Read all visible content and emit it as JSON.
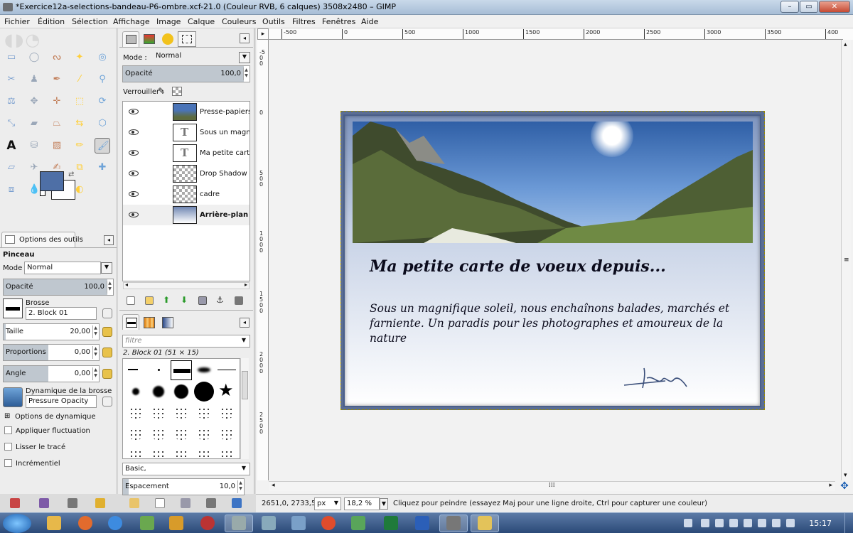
{
  "window": {
    "title": "*Exercice12a-selections-bandeau-P6-ombre.xcf-21.0 (Couleur RVB, 6 calques) 3508x2480 – GIMP",
    "minimize": "–",
    "maximize": "▭",
    "close": "✕"
  },
  "menu": [
    "Fichier",
    "Édition",
    "Sélection",
    "Affichage",
    "Image",
    "Calque",
    "Couleurs",
    "Outils",
    "Filtres",
    "Fenêtres",
    "Aide"
  ],
  "tool_options": {
    "tab_label": "Options des outils",
    "tool_name": "Pinceau",
    "mode_label": "Mode :",
    "mode_value": "Normal",
    "opacity_label": "Opacité",
    "opacity_value": "100,0",
    "opacity_fraction": 1.0,
    "brush_label": "Brosse",
    "brush_value": "2. Block 01",
    "size_label": "Taille",
    "size_value": "20,00",
    "size_fraction": 0.02,
    "aspect_label": "Proportions",
    "aspect_value": "0,00",
    "aspect_fraction": 0.5,
    "angle_label": "Angle",
    "angle_value": "0,00",
    "angle_fraction": 0.5,
    "dynamics_label": "Dynamique de la brosse",
    "dynamics_value": "Pressure Opacity",
    "dynamics_options": "Options de dynamique",
    "apply_jitter": "Appliquer fluctuation",
    "smooth_stroke": "Lisser le tracé",
    "incremental": "Incrémentiel"
  },
  "layers_panel": {
    "mode_label": "Mode :",
    "mode_value": "Normal",
    "opacity_label": "Opacité",
    "opacity_value": "100,0",
    "opacity_fraction": 1.0,
    "lock_label": "Verrouiller :",
    "layers": [
      {
        "name": "Presse-papiers",
        "thumb": "photo",
        "bold": false
      },
      {
        "name": "Sous un magnifi",
        "thumb": "text",
        "bold": false
      },
      {
        "name": "Ma petite carte d",
        "thumb": "text",
        "bold": false
      },
      {
        "name": "Drop Shadow",
        "thumb": "checker",
        "bold": false
      },
      {
        "name": "cadre",
        "thumb": "checker",
        "bold": false
      },
      {
        "name": "Arrière-plan",
        "thumb": "gradient",
        "bold": true
      }
    ]
  },
  "brushes_panel": {
    "filter_placeholder": "filtre",
    "selected_brush": "2. Block 01 (51 × 15)",
    "preset": "Basic,",
    "spacing_label": "Espacement",
    "spacing_value": "10,0",
    "spacing_fraction": 0.05
  },
  "rulers": {
    "h_labels": [
      "-500",
      "0",
      "500",
      "1000",
      "1500",
      "2000",
      "2500",
      "3000",
      "3500",
      "400"
    ],
    "v_labels": [
      "-500",
      "0",
      "500",
      "1000",
      "1500",
      "2000",
      "2500"
    ]
  },
  "card": {
    "title": "Ma petite carte de voeux depuis...",
    "body": "Sous un magnifique soleil, nous enchaînons balades, marchés et farniente. Un paradis pour les photographes et amoureux de la nature"
  },
  "status": {
    "coords": "2651,0, 2733,5",
    "unit": "px",
    "zoom": "18,2 %",
    "message": "Cliquez pour peindre (essayez Maj pour une ligne droite, Ctrl pour capturer une couleur)"
  },
  "taskbar": {
    "clock": "15:17"
  },
  "colors": {
    "foreground": "#4e6fa6",
    "background": "#ffffff",
    "card_border": "#4a5f8a"
  }
}
